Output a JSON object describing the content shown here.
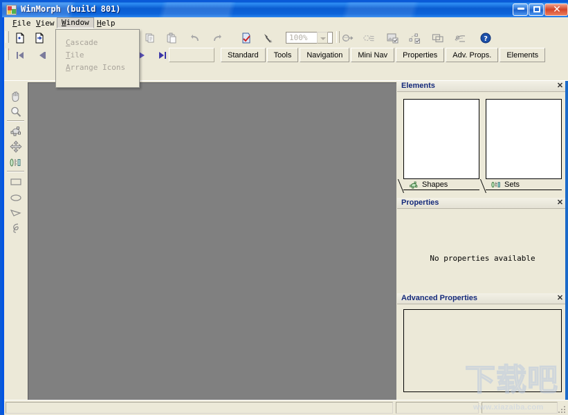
{
  "window": {
    "title": "WinMorph (build 801)",
    "icon": "app-icon",
    "buttons": {
      "minimize": "–",
      "maximize": "□",
      "close": "✕"
    }
  },
  "menubar": {
    "items": [
      {
        "label": "File",
        "accel": "F",
        "active": false
      },
      {
        "label": "View",
        "accel": "V",
        "active": false
      },
      {
        "label": "Window",
        "accel": "W",
        "active": true
      },
      {
        "label": "Help",
        "accel": "H",
        "active": false
      }
    ]
  },
  "window_menu": {
    "open": true,
    "items": [
      {
        "label": "Cascade",
        "accel": "C",
        "enabled": false
      },
      {
        "label": "Tile",
        "accel": "T",
        "enabled": false
      },
      {
        "label": "Arrange Icons",
        "accel": "A",
        "enabled": false
      }
    ]
  },
  "toolbar_standard": {
    "buttons": [
      {
        "name": "new-project-button",
        "icon": "new-document-icon",
        "enabled": true
      },
      {
        "name": "open-project-button",
        "icon": "open-document-icon",
        "enabled": true
      },
      {
        "name": "copy-button",
        "icon": "copy-icon",
        "enabled": false
      },
      {
        "name": "paste-button",
        "icon": "paste-icon",
        "enabled": false
      },
      {
        "name": "undo-button",
        "icon": "undo-arrow-icon",
        "enabled": false
      },
      {
        "name": "redo-button",
        "icon": "redo-arrow-icon",
        "enabled": false
      },
      {
        "name": "render-button",
        "icon": "checked-page-icon",
        "enabled": true
      },
      {
        "name": "tools-button",
        "icon": "hammer-icon",
        "enabled": true
      }
    ]
  },
  "zoom_control": {
    "value": "100%",
    "placeholder": "100%",
    "dropdown_icon": "chevron-down-icon"
  },
  "toolbar_tools": {
    "buttons": [
      {
        "name": "morph-button",
        "icon": "morph-ball-icon",
        "enabled": false
      },
      {
        "name": "warp-button",
        "icon": "warp-waves-icon",
        "enabled": false
      },
      {
        "name": "image-settings-button",
        "icon": "image-check-icon",
        "enabled": false
      },
      {
        "name": "mesh-check-button",
        "icon": "mesh-check-icon",
        "enabled": false
      },
      {
        "name": "layers-button",
        "icon": "layers-icon",
        "enabled": false
      },
      {
        "name": "preview-button",
        "icon": "preview-scene-icon",
        "enabled": false
      },
      {
        "name": "help-button",
        "icon": "help-circle-icon",
        "enabled": true
      }
    ]
  },
  "toolbar_navigation": {
    "buttons": [
      {
        "name": "first-frame-button",
        "icon": "skip-to-start-icon",
        "enabled": false
      },
      {
        "name": "previous-frame-button",
        "icon": "step-back-icon",
        "enabled": false
      },
      {
        "name": "play-button",
        "icon": "play-icon",
        "enabled": true
      },
      {
        "name": "last-frame-button",
        "icon": "skip-to-end-icon",
        "enabled": true
      }
    ]
  },
  "toolbar_tabs": {
    "items": [
      {
        "label": "Standard",
        "name": "tab-standard"
      },
      {
        "label": "Tools",
        "name": "tab-tools"
      },
      {
        "label": "Navigation",
        "name": "tab-navigation"
      },
      {
        "label": "Mini Nav",
        "name": "tab-mini-nav"
      },
      {
        "label": "Properties",
        "name": "tab-properties"
      },
      {
        "label": "Adv. Props.",
        "name": "tab-adv-props"
      },
      {
        "label": "Elements",
        "name": "tab-elements"
      }
    ]
  },
  "tool_palette": {
    "tools": [
      {
        "name": "pan-tool",
        "icon": "hand-icon",
        "group": 1
      },
      {
        "name": "zoom-tool",
        "icon": "magnifier-icon",
        "group": 1
      },
      {
        "name": "shape-tool",
        "icon": "shape-nodes-icon",
        "group": 2
      },
      {
        "name": "move-tool",
        "icon": "move-arrows-icon",
        "group": 2
      },
      {
        "name": "set-tool",
        "icon": "sets-icon",
        "group": 2
      },
      {
        "name": "rectangle-tool",
        "icon": "rectangle-icon",
        "group": 3
      },
      {
        "name": "ellipse-tool",
        "icon": "ellipse-icon",
        "group": 3
      },
      {
        "name": "polyline-tool",
        "icon": "polyline-icon",
        "group": 3
      },
      {
        "name": "curve-tool",
        "icon": "curve-icon",
        "group": 3
      }
    ]
  },
  "panels": {
    "elements": {
      "title": "Elements",
      "close_label": "✕",
      "tabs": [
        {
          "label": "Shapes",
          "icon": "shape-nodes-icon",
          "name": "elements-tab-shapes"
        },
        {
          "label": "Sets",
          "icon": "sets-icon",
          "name": "elements-tab-sets"
        }
      ]
    },
    "properties": {
      "title": "Properties",
      "close_label": "✕",
      "empty_message": "No properties available"
    },
    "advanced_properties": {
      "title": "Advanced Properties",
      "close_label": "✕"
    }
  },
  "watermark": {
    "chinese": "下载吧",
    "url": "www.xiazaiba.com"
  },
  "colors": {
    "title_bar_blue": "#0a5cd0",
    "panel_title": "#14297a",
    "canvas_gray": "#808080",
    "face": "#ece9d8",
    "close_red": "#d4462a"
  }
}
